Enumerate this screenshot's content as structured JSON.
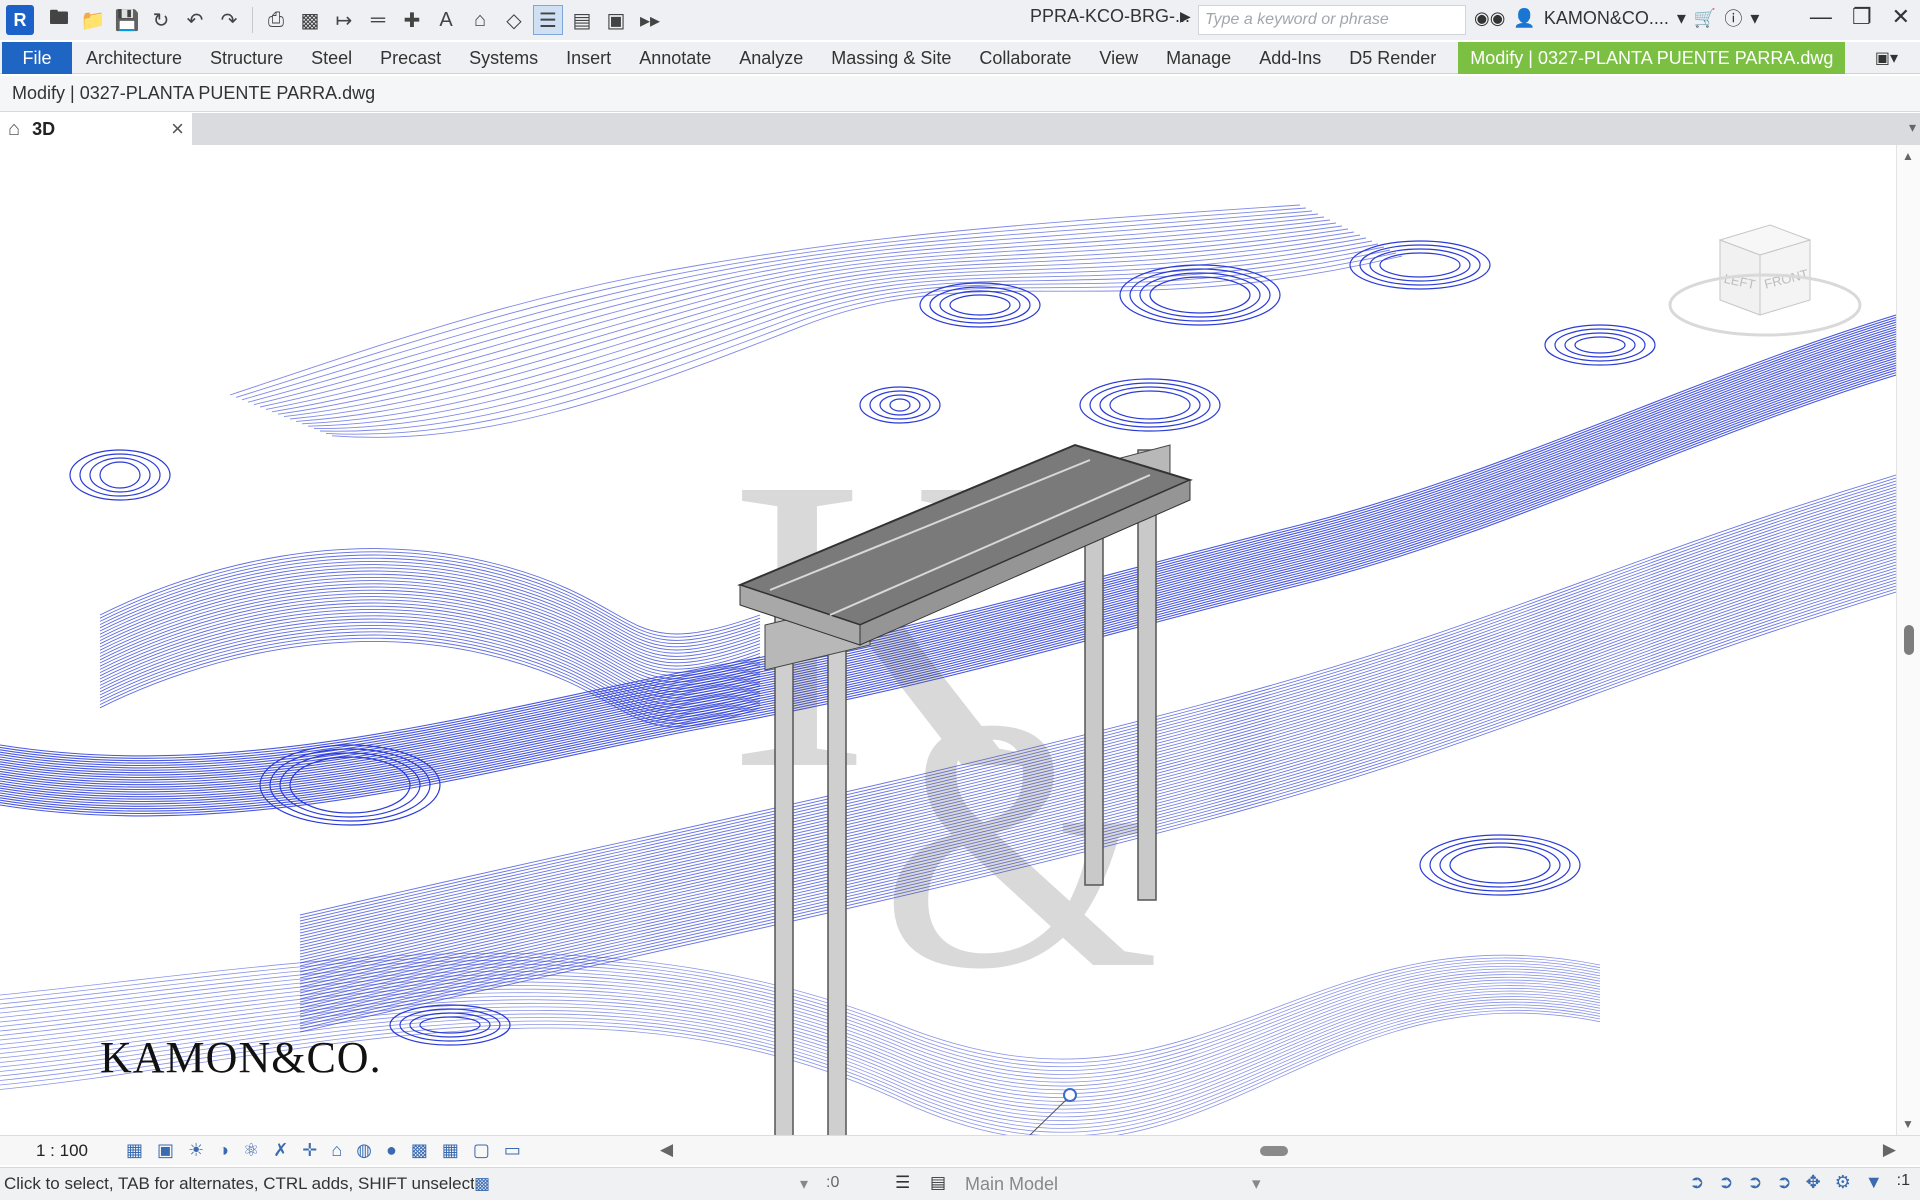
{
  "app": {
    "logo_letter": "R",
    "document_title": "PPRA-KCO-BRG-...",
    "search_placeholder": "Type a keyword or phrase",
    "user": "KAMON&CO....",
    "accent_color": "#1f66c4",
    "context_tab_color": "#7bc043"
  },
  "quick_access": {
    "icons": [
      "open-icon",
      "save-icon",
      "sync-icon",
      "undo-icon",
      "redo-icon",
      "print-icon",
      "export-icon",
      "measure-icon",
      "dimension-icon",
      "tag-icon",
      "text-icon",
      "3d-view-icon",
      "section-icon",
      "thin-lines-icon",
      "close-views-icon",
      "switch-windows-icon",
      "more-icon"
    ]
  },
  "ribbon": {
    "tabs": [
      "File",
      "Architecture",
      "Structure",
      "Steel",
      "Precast",
      "Systems",
      "Insert",
      "Annotate",
      "Analyze",
      "Massing & Site",
      "Collaborate",
      "View",
      "Manage",
      "Add-Ins",
      "D5 Render"
    ],
    "context_tab": "Modify | 0327-PLANTA PUENTE PARRA.dwg"
  },
  "options_bar": {
    "text": "Modify | 0327-PLANTA PUENTE PARRA.dwg"
  },
  "view_tab": {
    "label": "3D"
  },
  "viewcube": {
    "left": "LEFT",
    "front": "FRONT"
  },
  "watermark": {
    "brand": "KAMON&CO."
  },
  "view_control": {
    "scale": "1 : 100"
  },
  "status_bar": {
    "message": "Click to select, TAB for alternates, CTRL adds, SHIFT unselect",
    "selection_count": ":0",
    "active_model": "Main Model",
    "filter_count": ":1"
  }
}
